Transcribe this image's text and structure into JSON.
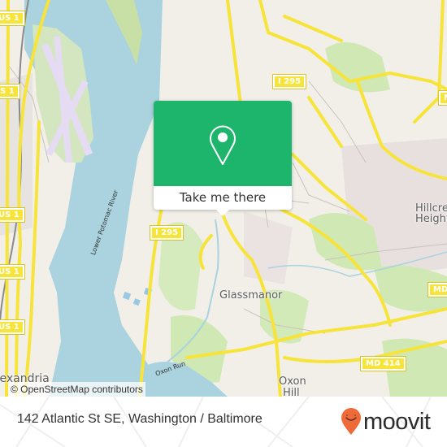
{
  "map": {
    "attribution": "© OpenStreetMap contributors",
    "place_labels": {
      "glassmanor": "Glassmanor",
      "oxon_hill_1": "Oxon",
      "oxon_hill_2": "Hill",
      "hillcrest_1": "Hillcrest",
      "hillcrest_2": "Heights",
      "alexandria": "Alexandria"
    },
    "water_labels": {
      "potomac": "Lower Potomac River",
      "oxon_run": "Oxon Run"
    },
    "road_shields": {
      "i295_top": "I 295",
      "i295_mid": "I 295",
      "us1_a": "US 1",
      "us1_b": "US 1",
      "us1_c": "US 1",
      "us1_d": "US 1",
      "us1_e": "US 1",
      "md414": "MD 414",
      "md_right": "MD",
      "md_top": "M"
    },
    "colors": {
      "water": "#aad3df",
      "land": "#f2efe9",
      "park": "#c8e6a8",
      "road": "#f6e43a",
      "popup_green": "#1db56b"
    }
  },
  "popup": {
    "button_label": "Take me there",
    "icon": "map-pin-icon"
  },
  "footer": {
    "address": "142 Atlantic St SE, Washington / Baltimore",
    "brand": "moovit",
    "brand_color": "#ef6a39"
  }
}
